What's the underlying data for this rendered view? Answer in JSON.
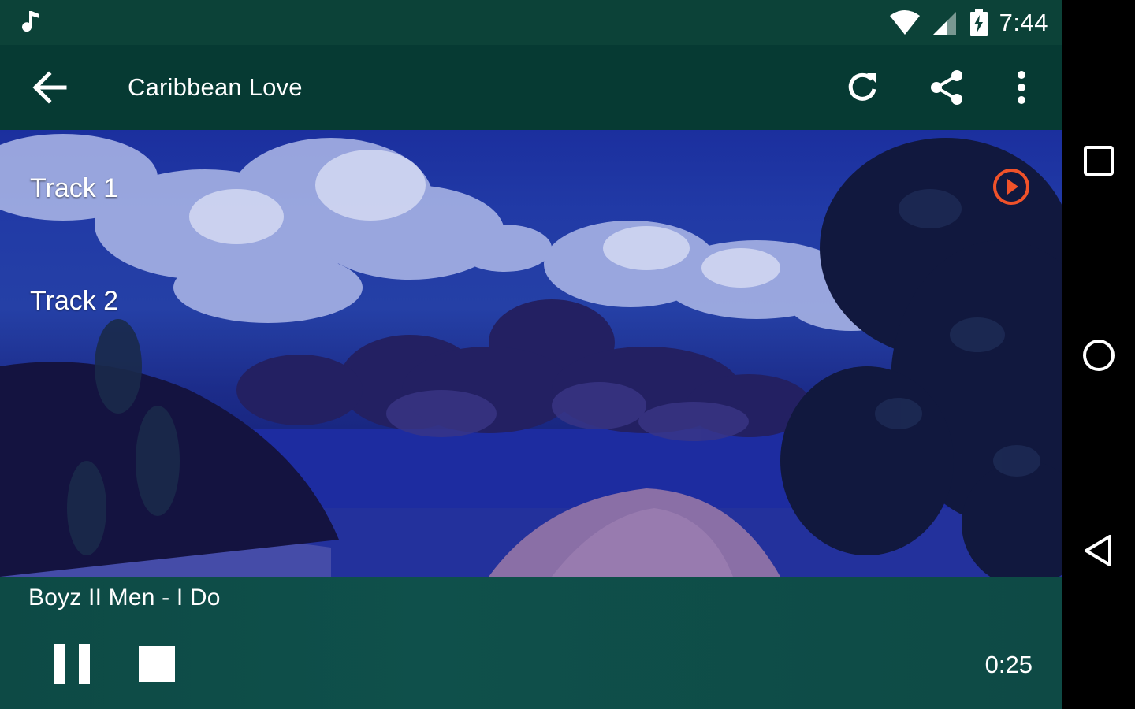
{
  "status_bar": {
    "time": "7:44",
    "icons": [
      "music-note-icon",
      "wifi-icon",
      "cell-signal-icon",
      "battery-charging-icon"
    ]
  },
  "app_bar": {
    "title": "Caribbean Love",
    "icons": [
      "back-arrow-icon",
      "refresh-icon",
      "share-icon",
      "more-vert-icon"
    ]
  },
  "tracks": [
    {
      "label": "Track 1",
      "playing": true
    },
    {
      "label": "Track 2",
      "playing": false
    }
  ],
  "player": {
    "song": "Boyz II Men - I Do",
    "elapsed": "0:25",
    "icons": [
      "pause-icon",
      "stop-icon"
    ]
  },
  "nav_bar": {
    "icons": [
      "recents-square-icon",
      "home-circle-icon",
      "back-triangle-icon"
    ]
  },
  "colors": {
    "status_bar": "#0c4238",
    "app_bar": "#063a33",
    "player_bg": "#0f504b",
    "accent_play": "#f0522a"
  }
}
